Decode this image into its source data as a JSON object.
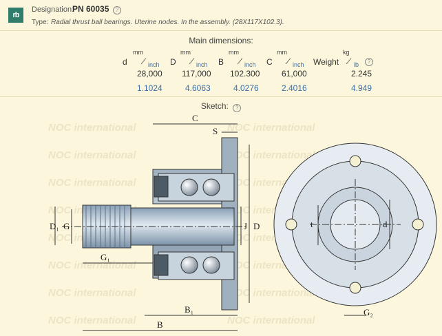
{
  "header": {
    "logo_text": "rb",
    "designation_label": "Designation:",
    "designation_value": "PN 60035",
    "type_label": "Type:",
    "type_value": "Radial thrust ball bearings. Uterine nodes. In the assembly. (28X117X102.3)."
  },
  "dimensions": {
    "title": "Main dimensions:",
    "unit_mm": "mm",
    "unit_inch": "inch",
    "unit_kg": "kg",
    "unit_lb": "lb",
    "weight_label": "Weight",
    "columns": [
      {
        "symbol": "d",
        "mm": "28,000",
        "inch": "1.1024"
      },
      {
        "symbol": "D",
        "mm": "117,000",
        "inch": "4.6063"
      },
      {
        "symbol": "B",
        "mm": "102.300",
        "inch": "4.0276"
      },
      {
        "symbol": "C",
        "mm": "61,000",
        "inch": "2.4016"
      }
    ],
    "weight": {
      "kg": "2.245",
      "lb": "4.949"
    }
  },
  "sketch": {
    "title": "Sketch",
    "watermark": "NOC international",
    "labels": {
      "C": "C",
      "S": "S",
      "D1": "D₁",
      "G": "G",
      "G1": "G₁",
      "J": "J",
      "D": "D",
      "B1": "B₁",
      "B": "B",
      "t": "t",
      "d": "d",
      "G2": "G₂"
    }
  }
}
